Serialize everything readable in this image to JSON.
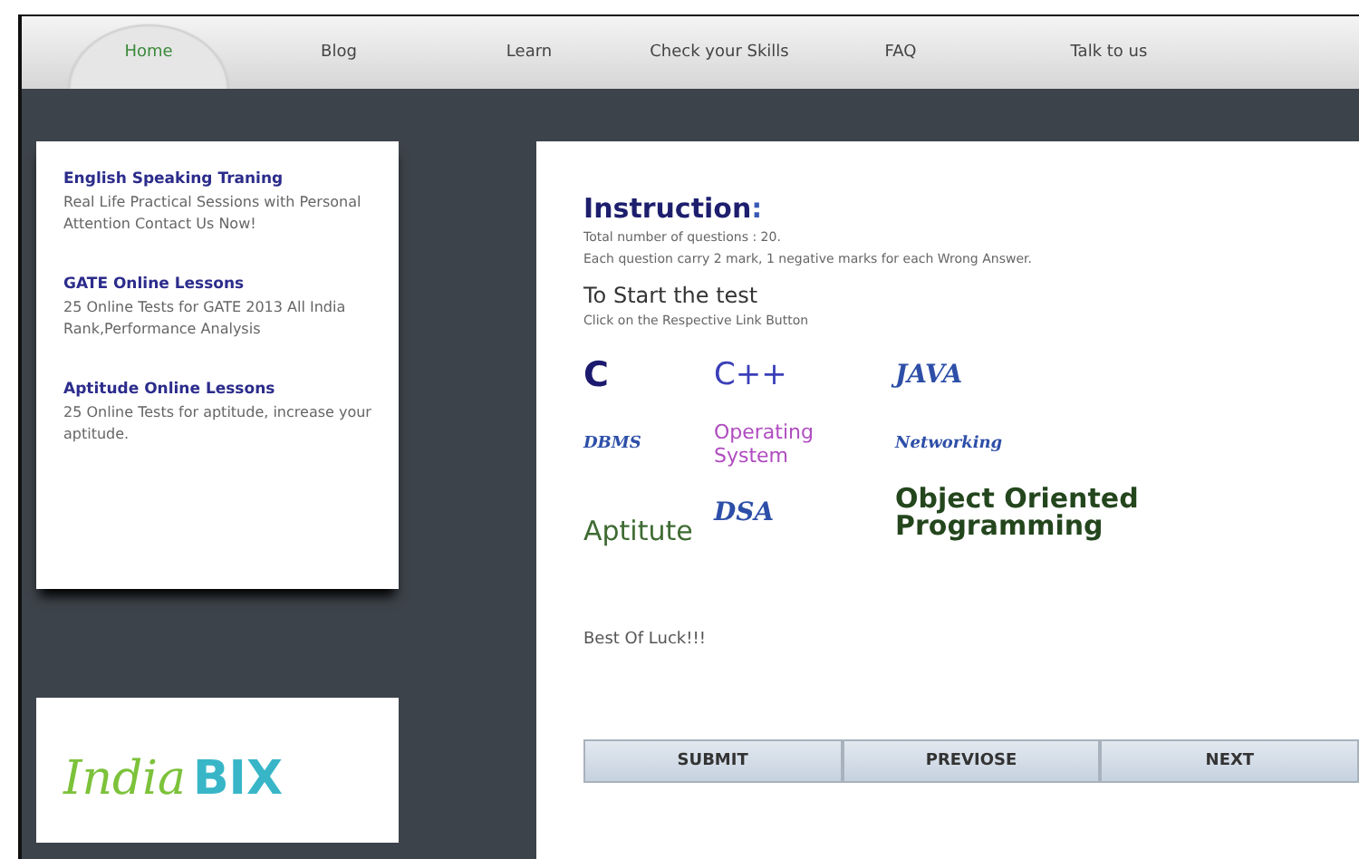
{
  "nav": [
    {
      "label": "Home",
      "selected": true
    },
    {
      "label": "Blog",
      "selected": false
    },
    {
      "label": "Learn",
      "selected": false
    },
    {
      "label": "Check your Skills",
      "selected": false
    },
    {
      "label": "FAQ",
      "selected": false
    },
    {
      "label": "Talk to us",
      "selected": false
    }
  ],
  "sidebar": {
    "items": [
      {
        "title": "English Speaking Traning",
        "text": "Real Life Practical Sessions with Personal Attention Contact Us Now!"
      },
      {
        "title": "GATE Online Lessons",
        "text": "25 Online Tests for GATE 2013 All India Rank,Performance Analysis"
      },
      {
        "title": "Aptitude Online Lessons",
        "text": "25 Online Tests for aptitude, increase your aptitude."
      }
    ],
    "logo": {
      "first": "India",
      "second": "BIX"
    }
  },
  "main": {
    "heading": "Instruction",
    "heading_mark": ":",
    "lines": [
      "Total number of questions : 20.",
      "Each question carry 2 mark, 1 negative marks for each Wrong Answer."
    ],
    "subheading": "To Start the test",
    "hint": "Click on the Respective Link Button",
    "tests": [
      {
        "label": "C",
        "kind": "bold",
        "color": "#1c1a6e"
      },
      {
        "label": "C++",
        "kind": "plain",
        "color": "#3a3fb8"
      },
      {
        "label": "JAVA",
        "kind": "script",
        "color": "#2e4fa8"
      },
      {
        "label": "DBMS",
        "kind": "script",
        "color": "#2e4fa8"
      },
      {
        "label": "Operating System",
        "kind": "plain",
        "color": "#b04cc0"
      },
      {
        "label": "Networking",
        "kind": "script",
        "color": "#2e4fa8"
      },
      {
        "label": "Aptitute",
        "kind": "plain",
        "color": "#3f6b33"
      },
      {
        "label": "DSA",
        "kind": "script",
        "color": "#2e4fa8"
      },
      {
        "label": "Object Oriented Programming",
        "kind": "bold",
        "color": "#24461d"
      }
    ],
    "closing": "Best Of Luck!!!",
    "buttons": [
      "SUBMIT",
      "PREVIOSE",
      "NEXT"
    ]
  }
}
